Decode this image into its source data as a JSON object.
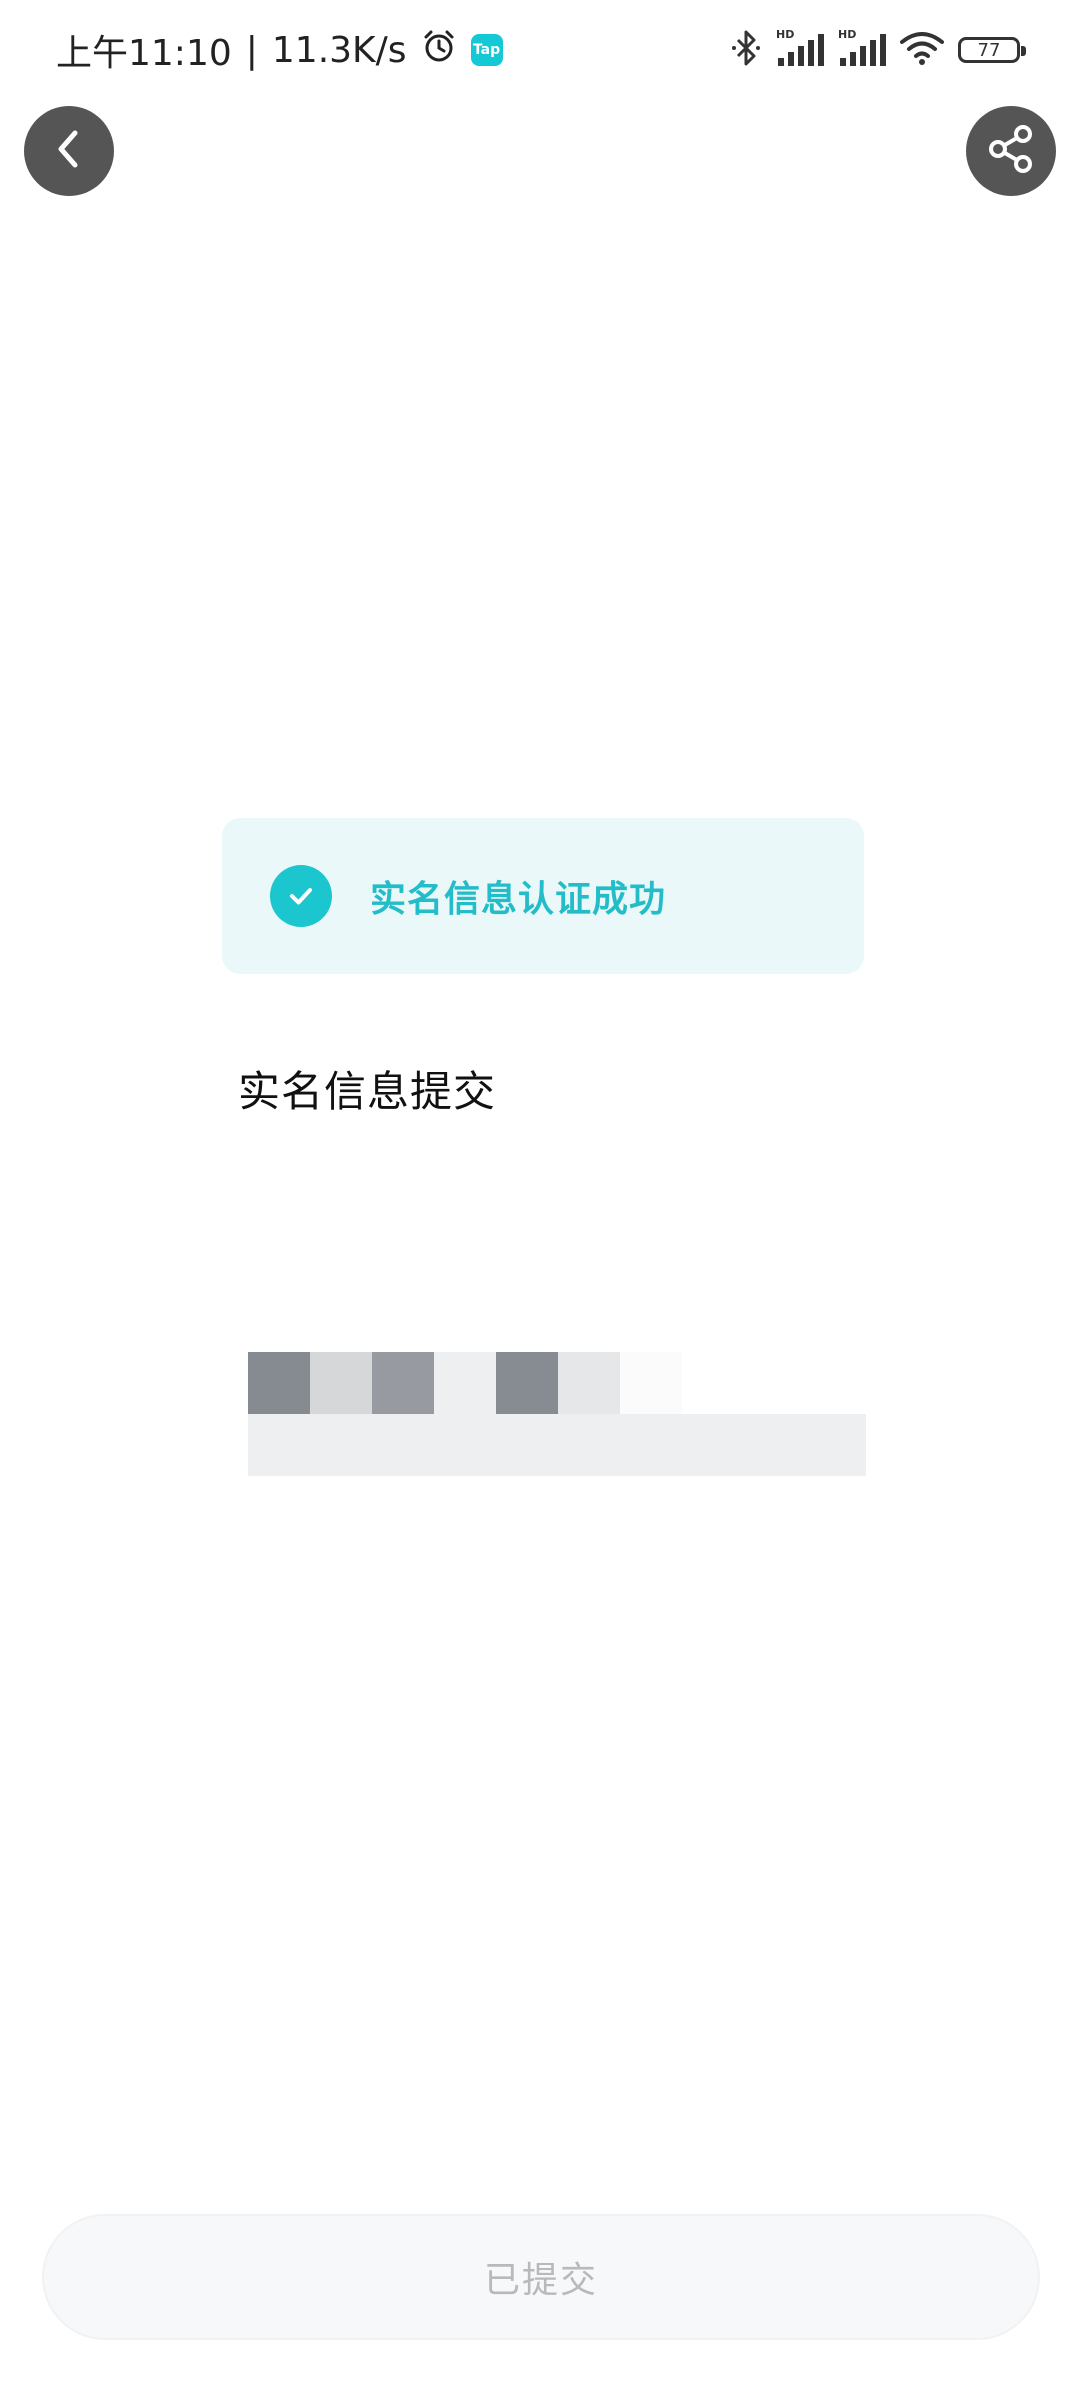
{
  "status_bar": {
    "time": "上午11:10",
    "separator": "|",
    "net_speed": "11.3K/s",
    "tap_badge": "Tap",
    "battery": "77",
    "icons": [
      "alarm-icon",
      "bluetooth-icon",
      "signal-hd-1-icon",
      "signal-hd-2-icon",
      "wifi-icon",
      "battery-icon"
    ]
  },
  "top_bar": {
    "back_icon": "chevron-left-icon",
    "share_icon": "share-icon"
  },
  "banner": {
    "icon": "check-circle-icon",
    "text": "实名信息认证成功",
    "accent_color": "#1cc6cf",
    "background": "#eaf8f9"
  },
  "section": {
    "title": "实名信息提交"
  },
  "redacted_info": {
    "mosaic_colors": [
      "#868a91",
      "#d6d7d8",
      "#979ba1",
      "#eeeff1",
      "#878b92",
      "#e6e7e9",
      "#fbfbfb"
    ],
    "strip_color": "#eeeff0"
  },
  "footer": {
    "submit_label": "已提交",
    "disabled": true
  }
}
